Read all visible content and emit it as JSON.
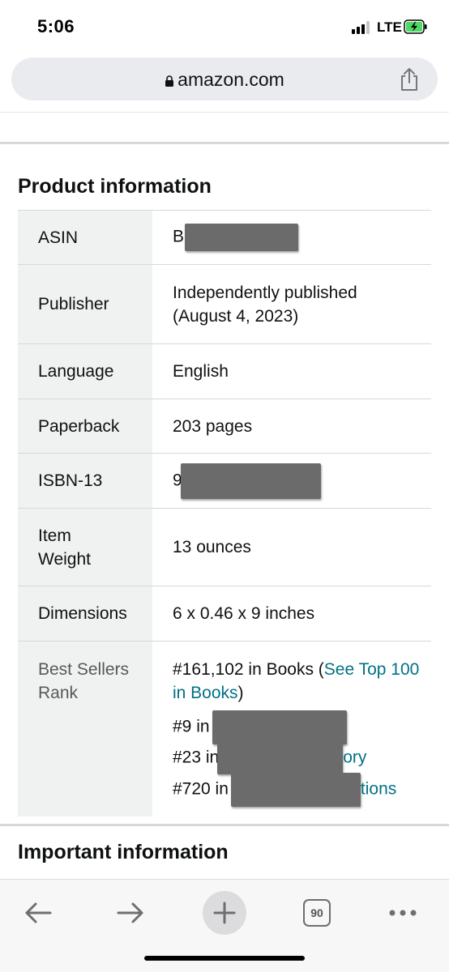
{
  "status_bar": {
    "time": "5:06",
    "network": "LTE"
  },
  "url_bar": {
    "domain": "amazon.com"
  },
  "product_information": {
    "title": "Product information",
    "rows": {
      "asin": {
        "label": "ASIN",
        "value_prefix": "B"
      },
      "publisher": {
        "label": "Publisher",
        "value": "Independently published (August 4, 2023)"
      },
      "language": {
        "label": "Language",
        "value": "English"
      },
      "paperback": {
        "label": "Paperback",
        "value": "203 pages"
      },
      "isbn13": {
        "label": "ISBN-13",
        "value_prefix": "9"
      },
      "item_weight": {
        "label": "Item Weight",
        "value": "13 ounces"
      },
      "dimensions": {
        "label": "Dimensions",
        "value": "6 x 0.46 x 9 inches"
      },
      "best_sellers_rank": {
        "label": "Best Sellers Rank",
        "main_rank": "#161,102 in Books (",
        "main_link": "See Top 100 in Books",
        "main_close": ")",
        "sub_ranks": [
          {
            "prefix": "#9 in",
            "suffix": ""
          },
          {
            "prefix": "#23 in",
            "suffix": "ory"
          },
          {
            "prefix": "#720 in",
            "suffix": "tions"
          }
        ]
      }
    }
  },
  "important_information": {
    "title": "Important information"
  },
  "toolbar": {
    "tab_count": "90"
  },
  "colors": {
    "link": "#007185",
    "header_cell_bg": "#f0f2f2",
    "border": "#d5d9d9",
    "redaction": "#6b6b6b"
  }
}
